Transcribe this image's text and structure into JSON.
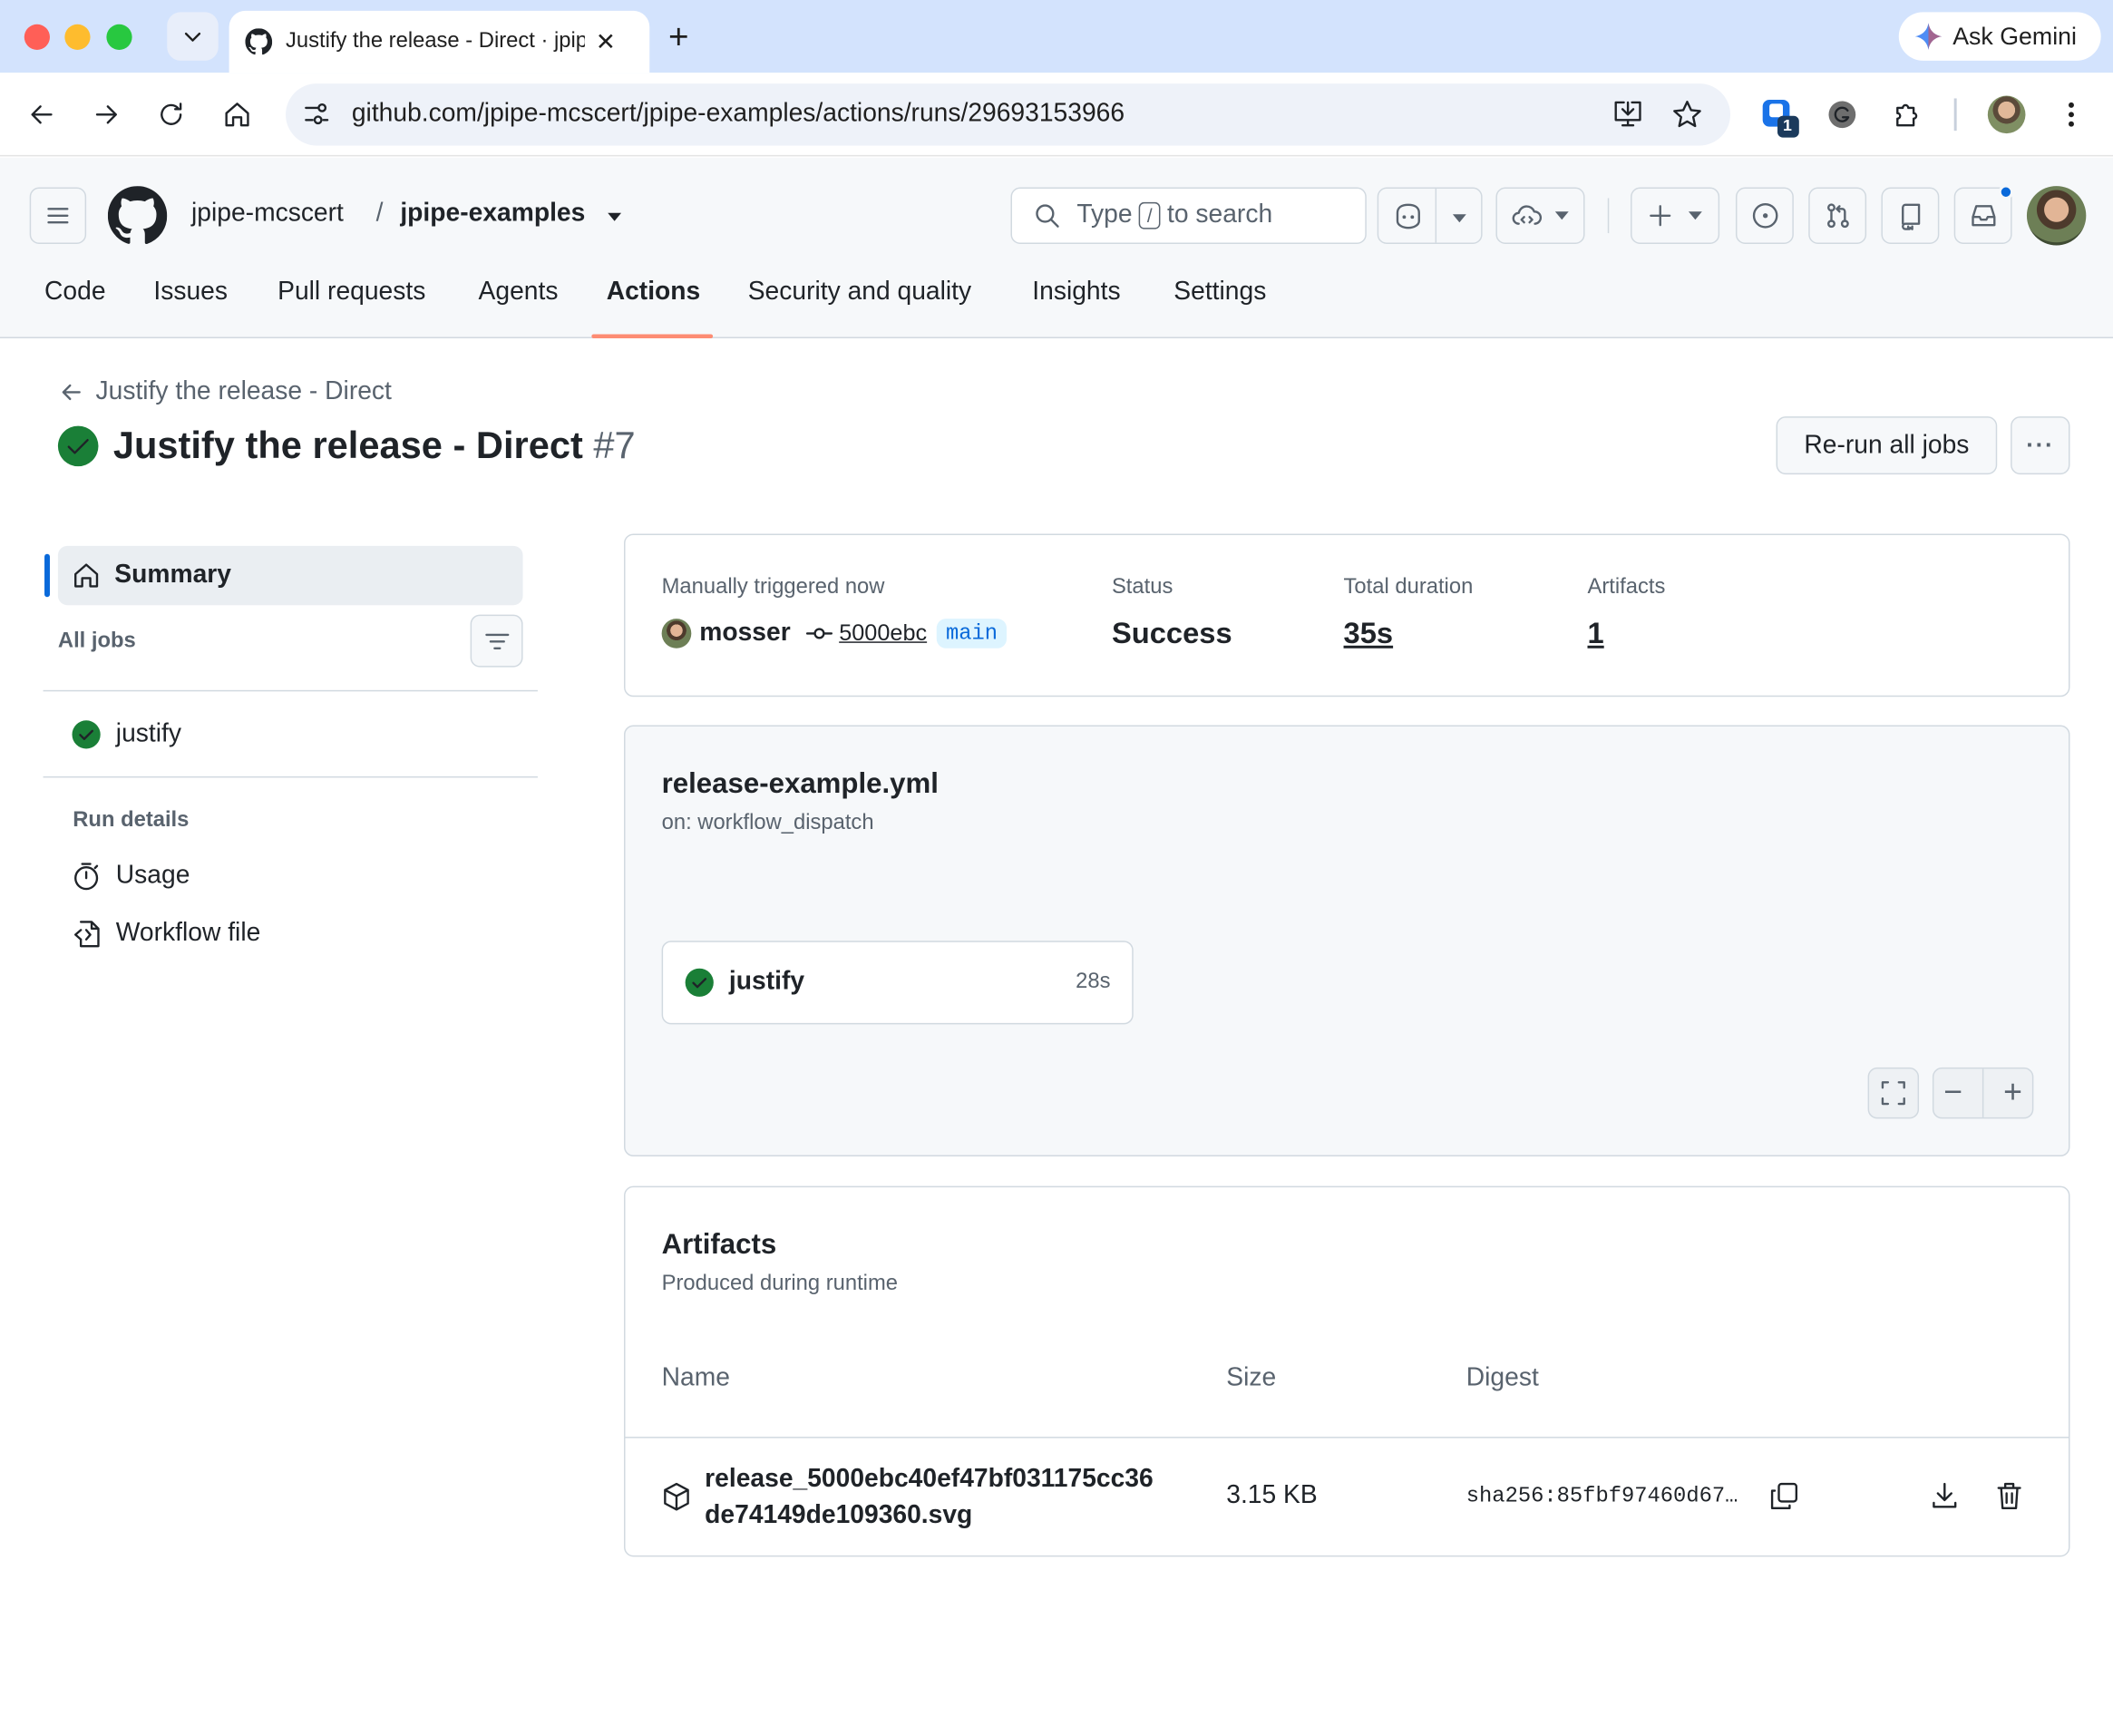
{
  "browser": {
    "tab_title": "Justify the release - Direct · jpipe-mcscert/jpipe-examples",
    "gemini_label": "Ask Gemini",
    "url": "github.com/jpipe-mcscert/jpipe-examples/actions/runs/29693153966",
    "extension_badge": "1"
  },
  "header": {
    "owner": "jpipe-mcscert",
    "separator": "/",
    "repo": "jpipe-examples",
    "search": {
      "prefix": "Type",
      "key": "/",
      "suffix": "to search"
    }
  },
  "nav": {
    "tabs": [
      "Code",
      "Issues",
      "Pull requests",
      "Agents",
      "Actions",
      "Security and quality",
      "Insights",
      "Settings"
    ],
    "active": "Actions"
  },
  "run": {
    "breadcrumb": "Justify the release - Direct",
    "title": "Justify the release - Direct",
    "number": "#7",
    "rerun_label": "Re-run all jobs",
    "more_label": "···"
  },
  "sidebar": {
    "summary": "Summary",
    "all_jobs": "All jobs",
    "jobs": [
      {
        "name": "justify",
        "status": "success"
      }
    ],
    "run_details": "Run details",
    "details": [
      {
        "label": "Usage",
        "icon": "stopwatch-icon"
      },
      {
        "label": "Workflow file",
        "icon": "file-code-icon"
      }
    ]
  },
  "summary": {
    "trigger_label": "Manually triggered now",
    "user": "mosser",
    "commit": "5000ebc",
    "branch": "main",
    "status_label": "Status",
    "status": "Success",
    "duration_label": "Total duration",
    "duration": "35s",
    "artifacts_label": "Artifacts",
    "artifacts_count": "1"
  },
  "workflow": {
    "file": "release-example.yml",
    "trigger": "on: workflow_dispatch",
    "job": {
      "name": "justify",
      "duration": "28s"
    },
    "zoom_out": "−",
    "zoom_in": "+"
  },
  "artifacts": {
    "title": "Artifacts",
    "subtitle": "Produced during runtime",
    "columns": [
      "Name",
      "Size",
      "Digest"
    ],
    "rows": [
      {
        "name_line1": "release_5000ebc40ef47bf031175cc36",
        "name_line2": "de74149de109360.svg",
        "size": "3.15 KB",
        "digest": "sha256:85fbf97460d67…"
      }
    ]
  },
  "colors": {
    "success": "#1a7f37",
    "accent": "#0969da",
    "nav_underline": "#fd8c73",
    "chrome_tab": "#d3e3fd"
  }
}
